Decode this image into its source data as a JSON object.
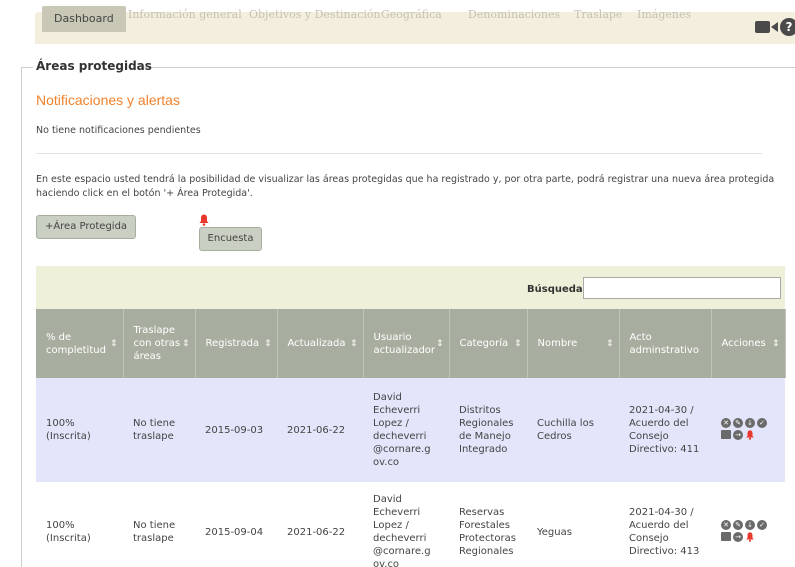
{
  "tabs": [
    {
      "label": "Dashboard"
    },
    {
      "label": "Información general"
    },
    {
      "label": "Objetivos y Destinación"
    },
    {
      "label": "Geográfica"
    },
    {
      "label": "Denominaciones"
    },
    {
      "label": "Traslape"
    },
    {
      "label": "Imágenes"
    }
  ],
  "section": {
    "legend": "Áreas protegidas"
  },
  "notifications": {
    "title": "Notificaciones y alertas",
    "text": "No tiene notificaciones pendientes"
  },
  "info": {
    "text": "En este espacio usted tendrá la posibilidad de visualizar las áreas protegidas que ha registrado y, por otra parte, podrá registrar una nueva área protegida haciendo click en el botón '+ Área Protegida'."
  },
  "buttons": {
    "add_area": "+Área Protegida",
    "survey": "Encuesta"
  },
  "search": {
    "label": "Búsqueda:",
    "value": ""
  },
  "table": {
    "headers": [
      "% de completitud",
      "Traslape con otras áreas",
      "Registrada",
      "Actualizada",
      "Usuario actualizador",
      "Categoría",
      "Nombre",
      "Acto adminstrativo",
      "Acciones"
    ],
    "rows": [
      {
        "completitud": "100% (Inscrita)",
        "traslape": "No tiene traslape",
        "registrada": "2015-09-03",
        "actualizada": "2021-06-22",
        "usuario": "David Echeverri Lopez / decheverri @cornare.g ov.co",
        "categoria": "Distritos Regionales de Manejo Integrado",
        "nombre": "Cuchilla los Cedros",
        "acto": "2021-04-30 / Acuerdo del Consejo Directivo: 411"
      },
      {
        "completitud": "100% (Inscrita)",
        "traslape": "No tiene traslape",
        "registrada": "2015-09-04",
        "actualizada": "2021-06-22",
        "usuario": "David Echeverri Lopez / decheverri @cornare.g ov.co",
        "categoria": "Reservas Forestales Protectoras Regionales",
        "nombre": "Yeguas",
        "acto": "2021-04-30 / Acuerdo del Consejo Directivo: 413"
      }
    ]
  },
  "colors": {
    "accent_orange": "#f0822c",
    "header_bg": "#a8ae9f",
    "row_highlight": "#e3e5fa",
    "tabbar_bg": "#f3eedd",
    "alert_red": "#e8382c"
  },
  "icons": [
    "video-camera-icon",
    "help-icon",
    "bell-icon"
  ]
}
